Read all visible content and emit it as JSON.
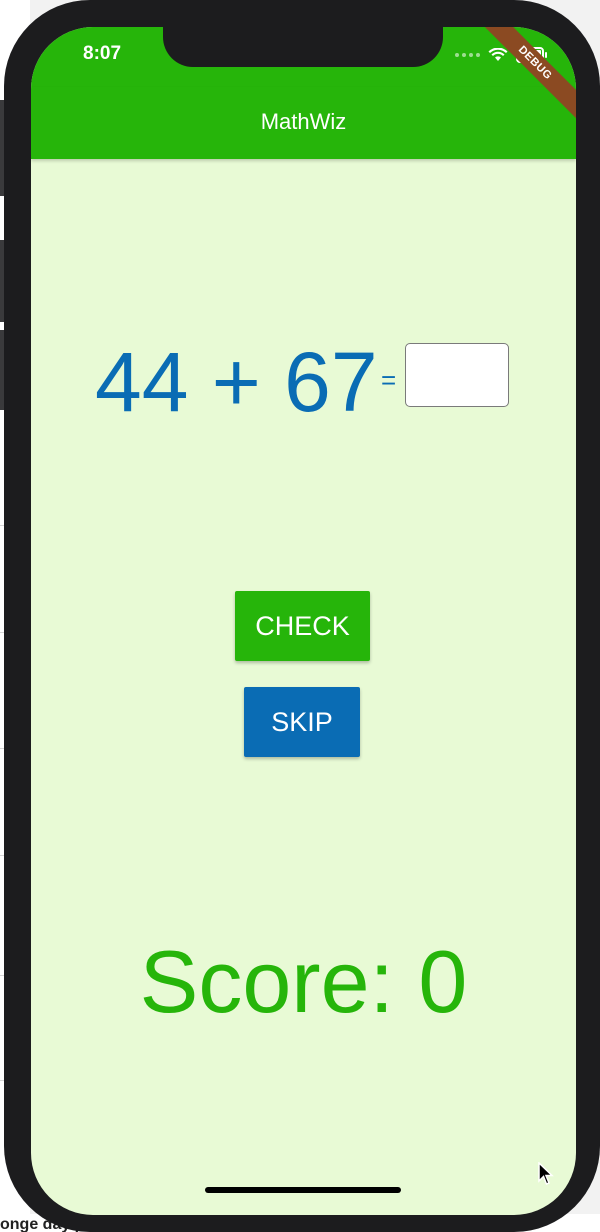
{
  "status_bar": {
    "time": "8:07"
  },
  "debug_banner": "DEBUG",
  "app_bar": {
    "title": "MathWiz"
  },
  "problem": {
    "expression": "44 + 67",
    "equals": "=",
    "answer_value": "",
    "answer_placeholder": ""
  },
  "actions": {
    "check_label": "CHECK",
    "skip_label": "SKIP"
  },
  "score": {
    "label": "Score: 0"
  },
  "background": {
    "bottom_text": "onge day p"
  },
  "colors": {
    "primary_green": "#26b50a",
    "primary_blue": "#0a6cb4",
    "screen_bg": "#e8fad5",
    "debug_banner": "#8b4a22"
  },
  "icons": [
    "wifi-icon",
    "battery-icon",
    "signal-dots-icon",
    "mouse-cursor-icon"
  ]
}
